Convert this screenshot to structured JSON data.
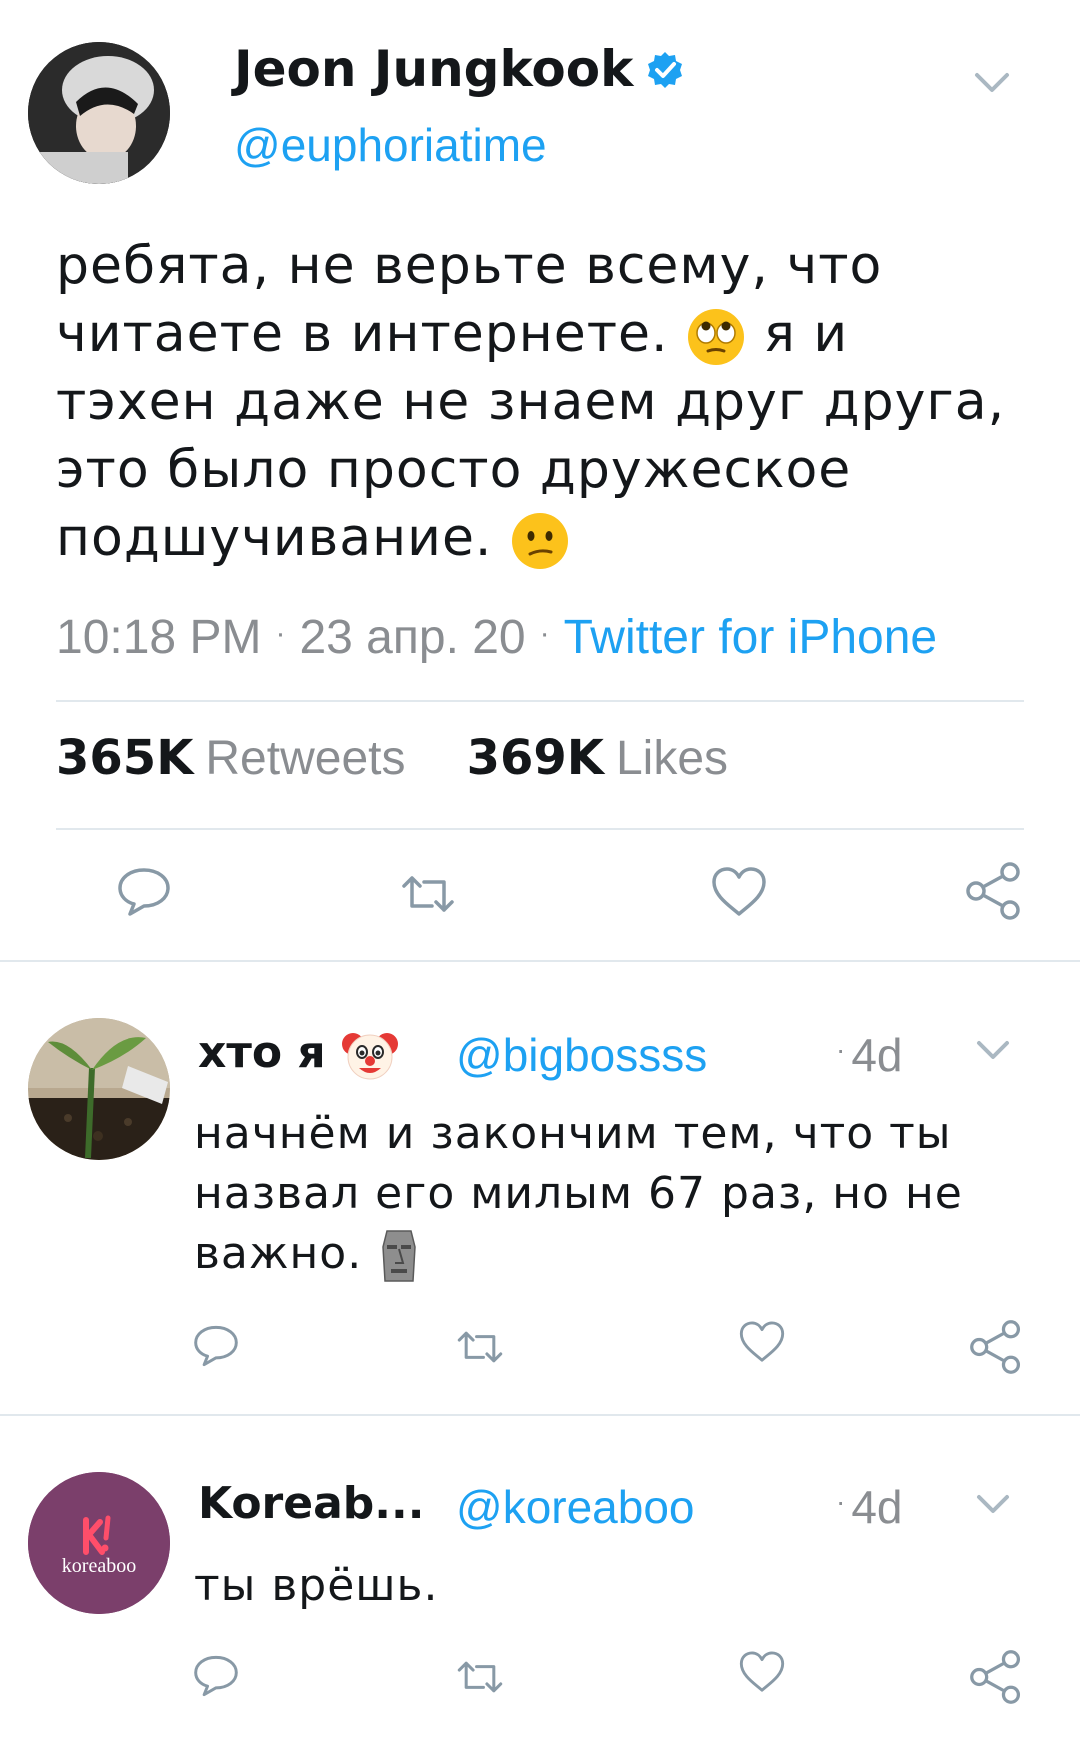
{
  "colors": {
    "accent": "#1da1f2",
    "muted": "#8a8d91",
    "divider": "#e1e8ed",
    "text": "#14171a"
  },
  "main_tweet": {
    "name": "Jeon Jungkook",
    "handle": "@euphoriatime",
    "verified": true,
    "text_lines": [
      "ребята, не верьте всему, что",
      "читаете в интернете.",
      "я и",
      "тэхен даже не знаем друг друга,",
      "это было просто дружеское",
      "подшучивание."
    ],
    "emojis": [
      "face-with-rolling-eyes",
      "confused-face"
    ],
    "time": "10:18 PM",
    "date": "23 апр. 20",
    "source": "Twitter for iPhone",
    "retweets_count": "365K",
    "retweets_label": "Retweets",
    "likes_count": "369K",
    "likes_label": "Likes"
  },
  "replies": [
    {
      "name": "хто я",
      "name_emoji": "clown-face",
      "handle": "@bigbossss",
      "time": "4d",
      "text_lines": [
        "начнём и закончим тем, что ты",
        "назвал его милым 67 раз, но не",
        "важно."
      ],
      "text_emoji": "moai"
    },
    {
      "name": "Koreab...",
      "handle": "@koreaboo",
      "time": "4d",
      "avatar_text": "koreaboo",
      "text_lines": [
        "ты врёшь."
      ]
    }
  ],
  "icons": [
    "reply-icon",
    "retweet-icon",
    "like-icon",
    "share-icon",
    "chevron-down-icon",
    "verified-badge-icon"
  ]
}
